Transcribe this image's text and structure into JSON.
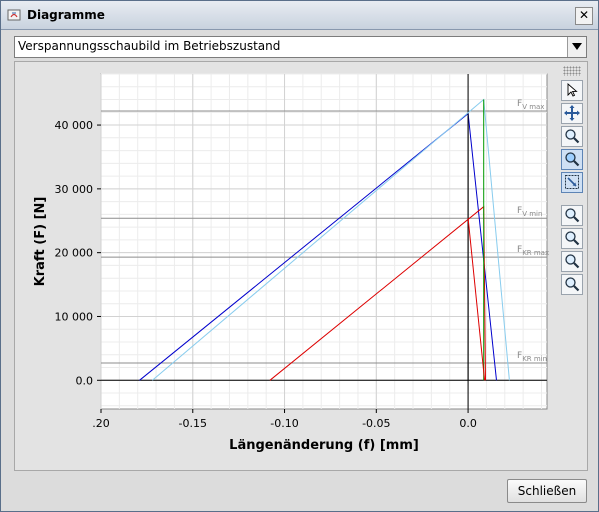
{
  "window": {
    "title": "Diagramme",
    "close_glyph": "✕"
  },
  "diagram_select": {
    "selected": "Verspannungsschaubild im Betriebszustand"
  },
  "toolbar": {
    "icons": [
      "pointer-icon",
      "pan-icon",
      "zoom-icon",
      "zoom-active-icon",
      "zoom-fit-icon",
      "zoom-in-icon",
      "zoom-out-icon",
      "zoom-x-icon",
      "zoom-y-icon"
    ]
  },
  "buttons": {
    "close_label": "Schließen"
  },
  "chart_data": {
    "type": "line",
    "xlabel": "Längenänderung (f) [mm]",
    "ylabel": "Kraft (F) [N]",
    "xlim": [
      -0.2,
      0.043
    ],
    "ylim": [
      -4500,
      48000
    ],
    "x_ticks": [
      {
        "value": -0.2,
        "label": ".20"
      },
      {
        "value": -0.15,
        "label": "-0.15"
      },
      {
        "value": -0.1,
        "label": "-0.10"
      },
      {
        "value": -0.05,
        "label": "-0.05"
      },
      {
        "value": 0.0,
        "label": "0.0"
      }
    ],
    "y_ticks": [
      {
        "value": 0,
        "label": "0.0"
      },
      {
        "value": 10000,
        "label": "10 000"
      },
      {
        "value": 20000,
        "label": "20 000"
      },
      {
        "value": 30000,
        "label": "30 000"
      },
      {
        "value": 40000,
        "label": "40 000"
      }
    ],
    "grid": true,
    "reference_lines": [
      {
        "label_main": "F",
        "label_sub": "V max",
        "y": 42200
      },
      {
        "label_main": "F",
        "label_sub": "V min",
        "y": 25400
      },
      {
        "label_main": "F",
        "label_sub": "KR max",
        "y": 19300
      },
      {
        "label_main": "F",
        "label_sub": "KR min",
        "y": 2700
      }
    ],
    "series": [
      {
        "color": "#0000cc",
        "points": [
          [
            -0.179,
            0
          ],
          [
            0,
            41800
          ],
          [
            0.0155,
            0
          ]
        ]
      },
      {
        "color": "#88ccee",
        "points": [
          [
            -0.172,
            0
          ],
          [
            0.0085,
            44000
          ],
          [
            0.0225,
            0
          ]
        ]
      },
      {
        "color": "#dd0000",
        "points": [
          [
            -0.108,
            0
          ],
          [
            0.0085,
            27200
          ],
          [
            0.0095,
            0
          ]
        ]
      },
      {
        "color": "#009900",
        "points": [
          [
            0.0085,
            44000
          ],
          [
            0.0085,
            0
          ]
        ]
      },
      {
        "color": "#000000",
        "points": [
          [
            0,
            41800
          ],
          [
            0,
            0
          ]
        ]
      },
      {
        "color": "#dd0000",
        "points": [
          [
            0,
            25400
          ],
          [
            0.009,
            0
          ]
        ]
      }
    ]
  }
}
